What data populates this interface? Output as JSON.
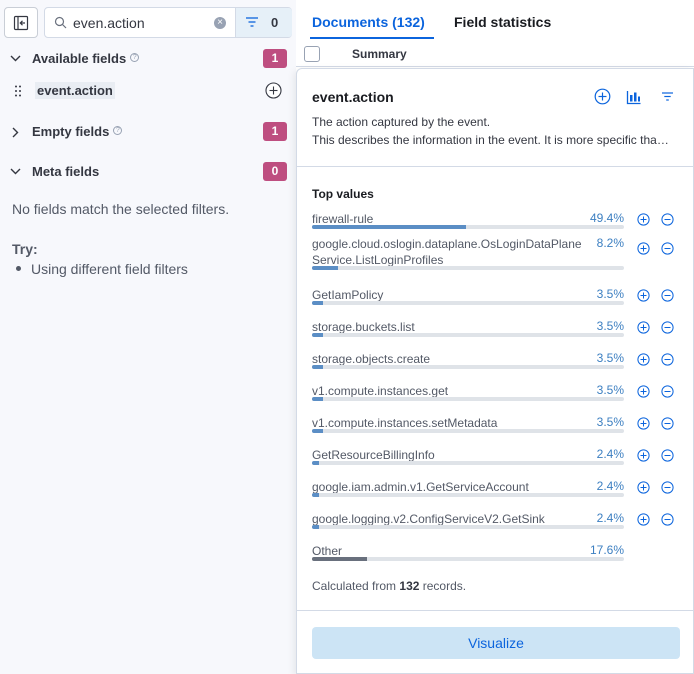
{
  "sidebar": {
    "search": {
      "value": "even.action",
      "filter_count": "0"
    },
    "available": {
      "label": "Available fields",
      "count": "1"
    },
    "field": {
      "name": "event.action"
    },
    "empty": {
      "label": "Empty fields",
      "count": "1"
    },
    "meta": {
      "label": "Meta fields",
      "count": "0"
    },
    "no_match": "No fields match the selected filters.",
    "try_label": "Try:",
    "try_items": [
      "Using different field filters"
    ]
  },
  "tabs": {
    "documents": "Documents (132)",
    "field_statistics": "Field statistics"
  },
  "grid": {
    "summary_header": "Summary"
  },
  "popover": {
    "title": "event.action",
    "description_1": "The action captured by the event.",
    "description_2": "This describes the information in the event. It is more specific than event.category.",
    "top_values_label": "Top values",
    "top_values": [
      {
        "label": "firewall-rule",
        "pct_label": "49.4%",
        "pct": 49.4
      },
      {
        "label": "google.cloud.oslogin.dataplane.OsLoginDataPlaneService.ListLoginProfiles",
        "pct_label": "8.2%",
        "pct": 8.2
      },
      {
        "label": "GetIamPolicy",
        "pct_label": "3.5%",
        "pct": 3.5
      },
      {
        "label": "storage.buckets.list",
        "pct_label": "3.5%",
        "pct": 3.5
      },
      {
        "label": "storage.objects.create",
        "pct_label": "3.5%",
        "pct": 3.5
      },
      {
        "label": "v1.compute.instances.get",
        "pct_label": "3.5%",
        "pct": 3.5
      },
      {
        "label": "v1.compute.instances.setMetadata",
        "pct_label": "3.5%",
        "pct": 3.5
      },
      {
        "label": "GetResourceBillingInfo",
        "pct_label": "2.4%",
        "pct": 2.4
      },
      {
        "label": "google.iam.admin.v1.GetServiceAccount",
        "pct_label": "2.4%",
        "pct": 2.4
      },
      {
        "label": "google.logging.v2.ConfigServiceV2.GetSink",
        "pct_label": "2.4%",
        "pct": 2.4
      }
    ],
    "other": {
      "label": "Other",
      "pct_label": "17.6%",
      "pct": 17.6
    },
    "calc_prefix": "Calculated from",
    "calc_count": "132",
    "calc_suffix": "records.",
    "visualize_label": "Visualize"
  },
  "colors": {
    "accent": "#0b64dd",
    "badge": "#be4e80",
    "bar": "#5b8ec5",
    "other_bar": "#69707d"
  },
  "icons": [
    "sidebar-toggle-icon",
    "search-icon",
    "clear-icon",
    "filter-icon",
    "chevron-down-icon",
    "chevron-right-icon",
    "help-icon",
    "drag-handle-icon",
    "add-icon",
    "plus-circle-icon",
    "minus-circle-icon",
    "visualize-icon"
  ]
}
